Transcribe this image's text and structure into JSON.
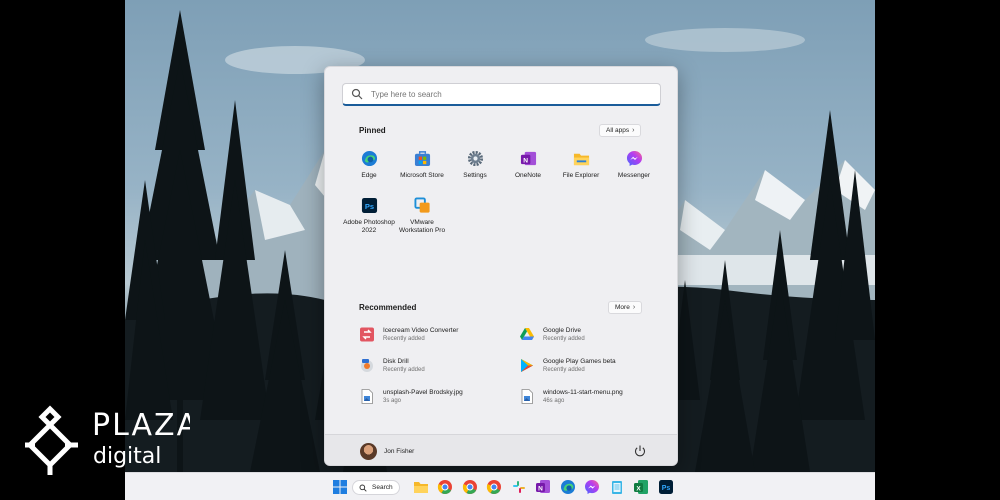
{
  "start_menu": {
    "search_placeholder": "Type here to search",
    "pinned": {
      "title": "Pinned",
      "all_apps_label": "All apps",
      "apps": [
        {
          "label": "Edge",
          "icon": "edge-icon"
        },
        {
          "label": "Microsoft Store",
          "icon": "store-icon"
        },
        {
          "label": "Settings",
          "icon": "gear-icon"
        },
        {
          "label": "OneNote",
          "icon": "onenote-icon"
        },
        {
          "label": "File Explorer",
          "icon": "folder-icon"
        },
        {
          "label": "Messenger",
          "icon": "messenger-icon"
        },
        {
          "label": "Adobe Photoshop 2022",
          "icon": "photoshop-icon"
        },
        {
          "label": "VMware Workstation Pro",
          "icon": "vmware-icon"
        }
      ]
    },
    "recommended": {
      "title": "Recommended",
      "more_label": "More",
      "items": [
        {
          "name": "Icecream Video Converter",
          "sub": "Recently added"
        },
        {
          "name": "Google Drive",
          "sub": "Recently added"
        },
        {
          "name": "Disk Drill",
          "sub": "Recently added"
        },
        {
          "name": "Google Play Games beta",
          "sub": "Recently added"
        },
        {
          "name": "unsplash-Pavel Brodsky.jpg",
          "sub": "3s ago"
        },
        {
          "name": "windows-11-start-menu.png",
          "sub": "46s ago"
        }
      ]
    },
    "user": {
      "name": "Jon Fisher"
    }
  },
  "taskbar": {
    "search_label": "Search",
    "icons": [
      "windows-start-icon",
      "search-icon",
      "file-explorer-icon",
      "chrome-icon",
      "chrome-icon",
      "chrome-icon",
      "slack-icon",
      "onenote-icon",
      "edge-icon",
      "messenger-icon",
      "notepad-icon",
      "excel-icon",
      "photoshop-icon"
    ]
  },
  "watermark": {
    "line1": "PLAZA",
    "line2": "digital"
  },
  "colors": {
    "accent": "#1a5c9a",
    "menu_bg": "#efeff2",
    "taskbar_bg": "#f1f1f4"
  }
}
